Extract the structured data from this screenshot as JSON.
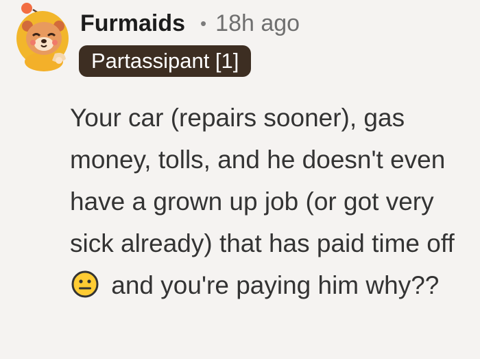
{
  "comment": {
    "username": "Furmaids",
    "separator": "•",
    "timestamp": "18h ago",
    "flair": "Partassipant [1]",
    "body_before_emoji": "Your car (repairs sooner), gas money, tolls, and he doesn't even have a grown up job (or got very sick already) that has paid time off",
    "body_after_emoji": "and you're paying him why??",
    "emoji_icon": "neutral-face-emoji-icon",
    "avatar_icon": "snoo-bear-avatar-icon"
  },
  "colors": {
    "background": "#f5f3f1",
    "flair_background": "#3d2e22",
    "flair_text": "#ffffff",
    "username": "#1c1c1c",
    "meta": "#6f6f6f",
    "body": "#333333"
  }
}
